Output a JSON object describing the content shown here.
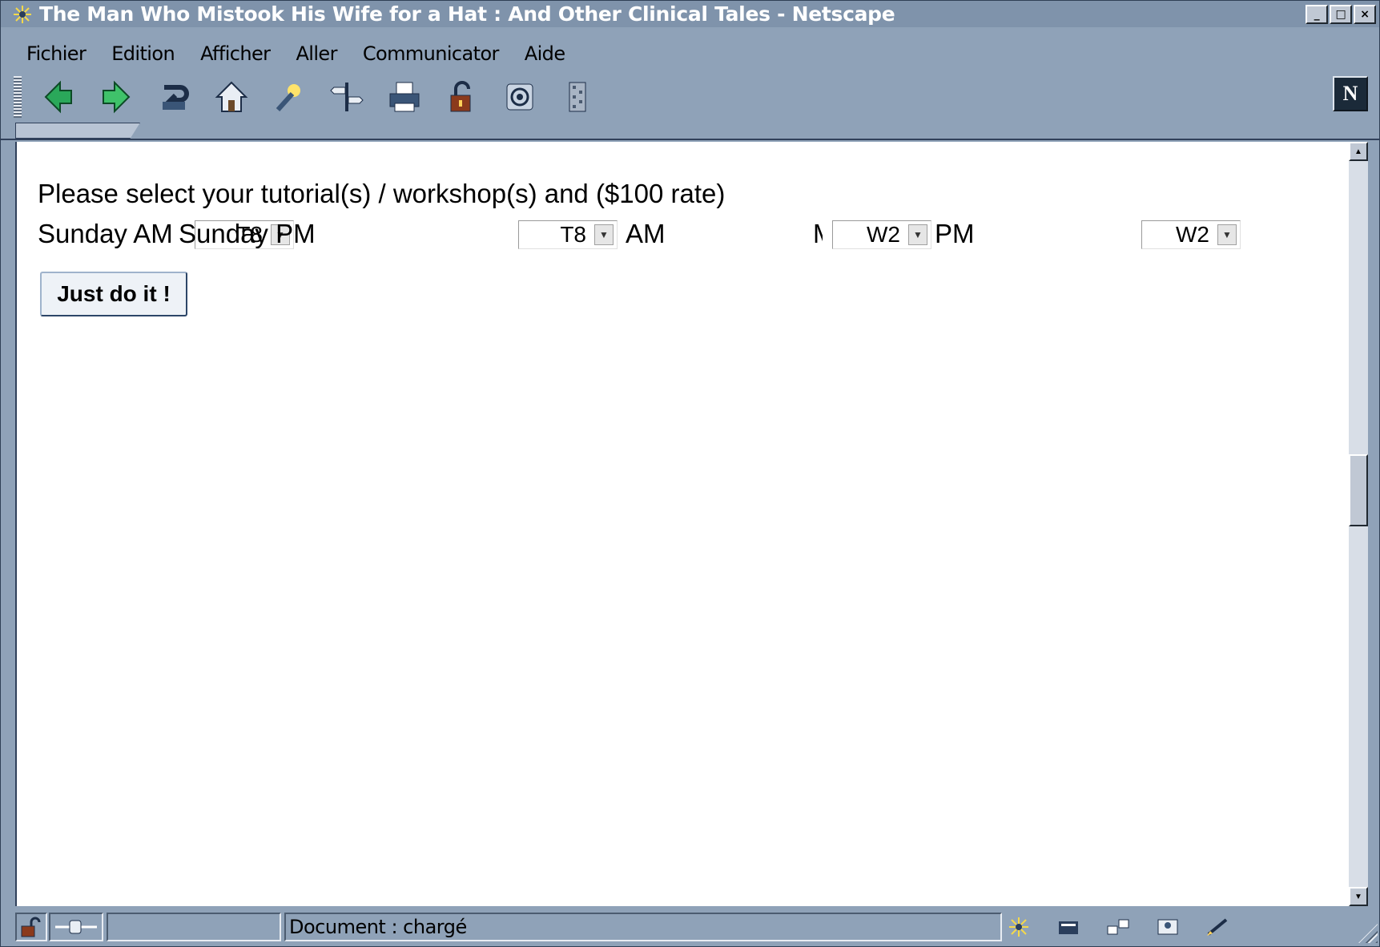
{
  "window": {
    "title": "The Man Who Mistook His Wife for a Hat : And Other Clinical Tales - Netscape",
    "controls": {
      "minimize": "_",
      "maximize": "□",
      "close": "×"
    }
  },
  "menu": {
    "items": [
      "Fichier",
      "Edition",
      "Afficher",
      "Aller",
      "Communicator",
      "Aide"
    ]
  },
  "toolbar": {
    "buttons": [
      "back-icon",
      "forward-icon",
      "reload-icon",
      "home-icon",
      "search-icon",
      "guide-icon",
      "print-icon",
      "security-icon",
      "shop-icon",
      "stop-icon"
    ],
    "logo": "N"
  },
  "content": {
    "heading": "Please select your tutorial(s) / workshop(s) and ($100 rate)",
    "labels": {
      "sunday_am": "Sunday AM",
      "sunday_pm": "Sunday PM",
      "monday_am": "AM",
      "monday_prefix": "M",
      "monday_pm": "PM"
    },
    "selects": {
      "sunday_am": "T8",
      "sunday_pm": "T8",
      "monday_am": "W2",
      "monday_pm": "W2"
    },
    "submit_label": "Just do it !"
  },
  "statusbar": {
    "text": "Document : chargé"
  },
  "colors": {
    "chrome": "#8fa2b8",
    "title_bar": "#7f93ab",
    "content_bg": "#ffffff"
  }
}
